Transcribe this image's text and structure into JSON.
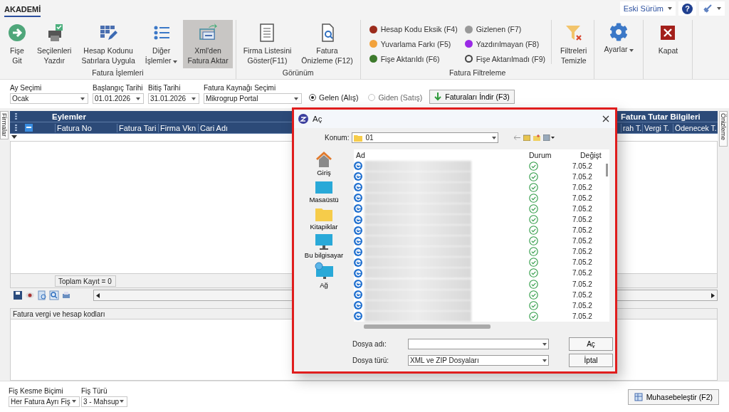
{
  "top_tab": {
    "label": "AKADEMİ",
    "selected": true
  },
  "top_right": {
    "version": "Eski Sürüm",
    "help": "?"
  },
  "ribbon_groups": [
    {
      "title": "Fatura İşlemleri",
      "buttons": [
        {
          "kind": "go",
          "lines": [
            "Fişe",
            "Git"
          ],
          "selected": false,
          "dropdown": false
        },
        {
          "kind": "print",
          "lines": [
            "Seçilenleri",
            "Yazdır"
          ],
          "selected": false,
          "dropdown": false
        },
        {
          "kind": "grid-edit",
          "lines": [
            "Hesap Kodunu",
            "Satırlara Uygula"
          ],
          "selected": false,
          "dropdown": false
        },
        {
          "kind": "list",
          "lines": [
            "Diğer",
            "İşlemler"
          ],
          "selected": false,
          "dropdown": true
        },
        {
          "kind": "xml",
          "lines": [
            "Xml'den",
            "Fatura Aktar"
          ],
          "selected": true,
          "dropdown": false
        }
      ]
    },
    {
      "title": "Görünüm",
      "buttons": [
        {
          "kind": "doc",
          "lines": [
            "Firma Listesini",
            "Göster(F11)"
          ],
          "selected": false,
          "dropdown": false
        },
        {
          "kind": "preview",
          "lines": [
            "Fatura",
            "Önizleme (F12)"
          ],
          "selected": false,
          "dropdown": false
        }
      ]
    },
    {
      "title": "Fatura Filtreleme",
      "legend": [
        {
          "label": "Hesap Kodu Eksik (F4)",
          "color": "#9b2b1c",
          "kind": "dot"
        },
        {
          "label": "Yuvarlama Farkı (F5)",
          "color": "#f2a23c",
          "kind": "dot"
        },
        {
          "label": "Fişe Aktarıldı (F6)",
          "color": "#3d7a2c",
          "kind": "dot"
        },
        {
          "label": "Gizlenen (F7)",
          "color": "#999999",
          "kind": "dot"
        },
        {
          "label": "Yazdırılmayan (F8)",
          "color": "#9a2ae6",
          "kind": "dot"
        },
        {
          "label": "Fişe Aktarılmadı (F9)",
          "color": "#444444",
          "kind": "ring"
        }
      ],
      "buttons": [
        {
          "kind": "filter-clear",
          "lines": [
            "Filtreleri",
            "Temizle"
          ],
          "selected": false,
          "dropdown": false
        }
      ]
    },
    {
      "buttons": [
        {
          "kind": "gear",
          "lines": [
            "Ayarlar"
          ],
          "selected": false,
          "dropdown": true
        }
      ]
    },
    {
      "buttons": [
        {
          "kind": "close",
          "lines": [
            "Kapat"
          ],
          "selected": false,
          "dropdown": false
        }
      ]
    }
  ],
  "filters": [
    {
      "label": "Ay Seçimi",
      "value": "Ocak"
    },
    {
      "label": "Başlangıç Tarihi",
      "value": "01.01.2026"
    },
    {
      "label": "Bitiş Tarihi",
      "value": "31.01.2026"
    },
    {
      "label": "Fatura Kaynağı Seçimi",
      "value": "Mikrogrup Portal"
    }
  ],
  "radios": [
    {
      "label": "Gelen (Alış)",
      "selected": true
    },
    {
      "label": "Giden (Satış)",
      "selected": false
    }
  ],
  "download_button": "Faturaları İndir (F3)",
  "side_tabs": {
    "left": "Firmalar",
    "right": "Önizleme"
  },
  "grid": {
    "group_left": "Eylemler",
    "group_right": "Fatura Tutar Bilgileri",
    "columns": [
      "Fatura No",
      "Fatura Tari",
      "Firma Vkn",
      "Cari Adı"
    ],
    "right_columns": [
      "rah T.",
      "Vergi T.",
      "Ödenecek T."
    ],
    "total": "Toplam Kayıt = 0"
  },
  "detail_panel": {
    "title": "Fatura vergi ve hesap kodları"
  },
  "bottom": {
    "fields": [
      {
        "label": "Fiş Kesme Biçimi",
        "value": "Her Fatura Ayrı Fiş"
      },
      {
        "label": "Fiş Türü",
        "value": "3 - Mahsup"
      }
    ],
    "button": "Muhasebeleştir (F2)"
  },
  "dialog": {
    "title": "Aç",
    "location_label": "Konum:",
    "location": "01",
    "places": [
      {
        "kind": "home",
        "label": "Giriş"
      },
      {
        "kind": "desktop",
        "label": "Masaüstü"
      },
      {
        "kind": "folder",
        "label": "Kitapiklar"
      },
      {
        "kind": "computer",
        "label": "Bu bilgisayar"
      },
      {
        "kind": "network",
        "label": "Ağ"
      }
    ],
    "columns": [
      "Ad",
      "Durum",
      "Değişt"
    ],
    "files": [
      {
        "modified": "7.05.2"
      },
      {
        "modified": "7.05.2"
      },
      {
        "modified": "7.05.2"
      },
      {
        "modified": "7.05.2"
      },
      {
        "modified": "7.05.2"
      },
      {
        "modified": "7.05.2"
      },
      {
        "modified": "7.05.2"
      },
      {
        "modified": "7.05.2"
      },
      {
        "modified": "7.05.2"
      },
      {
        "modified": "7.05.2"
      },
      {
        "modified": "7.05.2"
      },
      {
        "modified": "7.05.2"
      },
      {
        "modified": "7.05.2"
      },
      {
        "modified": "7.05.2"
      },
      {
        "modified": "7.05.2"
      }
    ],
    "filename_label": "Dosya adı:",
    "filetype_label": "Dosya türü:",
    "filetype": "XML ve ZIP Dosyaları",
    "open_button": "Aç",
    "cancel_button": "İptal"
  }
}
